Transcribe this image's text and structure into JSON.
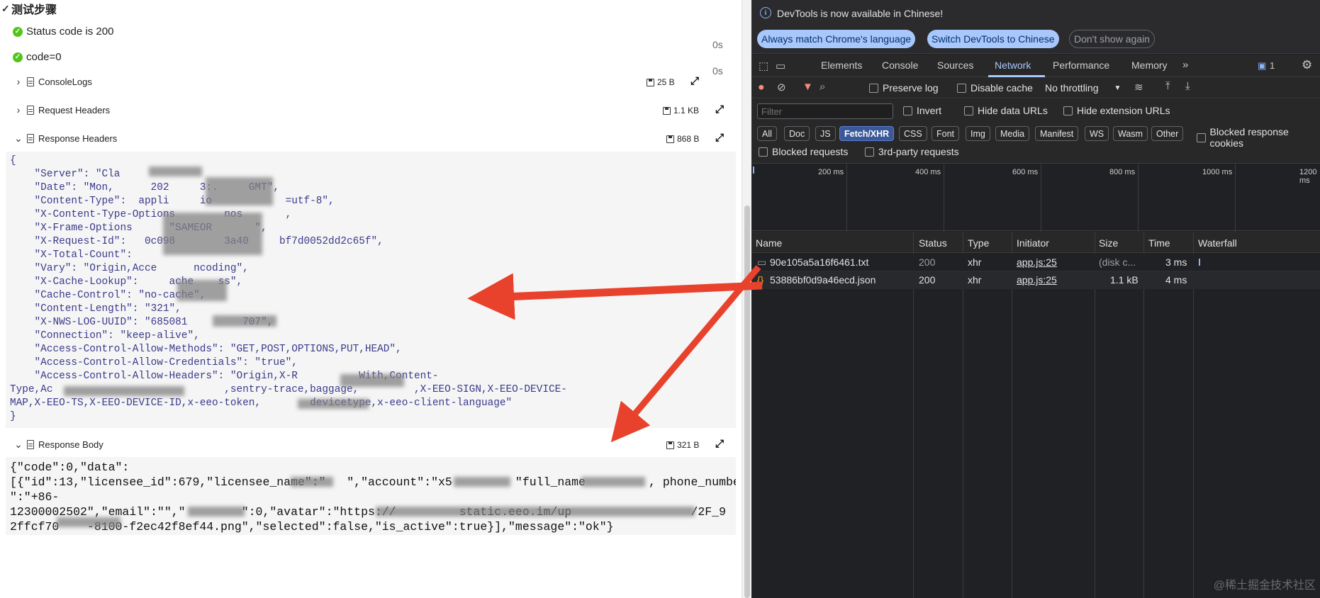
{
  "report": {
    "section_title": "测试步骤",
    "checks": [
      {
        "label": "Status code is 200",
        "duration": "0s"
      },
      {
        "label": "code=0",
        "duration": "0s"
      }
    ],
    "sections": [
      {
        "label": "ConsoleLogs",
        "size": "25 B",
        "expanded": false
      },
      {
        "label": "Request Headers",
        "size": "1.1 KB",
        "expanded": false
      },
      {
        "label": "Response Headers",
        "size": "868 B",
        "expanded": true
      },
      {
        "label": "Response Body",
        "size": "321 B",
        "expanded": true
      }
    ],
    "response_headers_lines": [
      "{",
      "    \"Server\": \"Cla",
      "    \"Date\": \"Mon,      202     3:.     GMT\",",
      "    \"Content-Type\":  appli     io            =utf-8\",",
      "    \"X-Content-Type-Options        nos       ,",
      "    \"X-Frame-Options      \"SAMEOR       \",",
      "    \"X-Request-Id\":   0c098        3a40     bf7d0052dd2c65f\",",
      "    \"X-Total-Count\":   ",
      "    \"Vary\": \"Origin,Acce      ncoding\",",
      "    \"X-Cache-Lookup\":     ache    ss\",",
      "    \"Cache-Control\": \"no-cache\",",
      "    \"Content-Length\": \"321\",",
      "    \"X-NWS-LOG-UUID\": \"685081         707\",",
      "    \"Connection\": \"keep-alive\",",
      "    \"Access-Control-Allow-Methods\": \"GET,POST,OPTIONS,PUT,HEAD\",",
      "    \"Access-Control-Allow-Credentials\": \"true\",",
      "    \"Access-Control-Allow-Headers\": \"Origin,X-R          With,Content-",
      "Type,Ac                            ,sentry-trace,baggage,         ,X-EEO-SIGN,X-EEO-DEVICE-",
      "MAP,X-EEO-TS,X-EEO-DEVICE-ID,x-eeo-token,        devicetype,x-eeo-client-language\"",
      "}"
    ],
    "response_body_lines": [
      "{\"code\":0,\"data\":",
      "[{\"id\":13,\"licensee_id\":679,\"licensee_name\":\"   \",\"account\":\"x5         \"full_name         , phone_number",
      "\":\"+86-",
      "12300002502\",\"email\":\"\",\"        \":0,\"avatar\":\"https://         static.eeo.im/up                 /2F_9",
      "2ffcf70    -8100-f2ec42f8ef44.png\",\"selected\":false,\"is_active\":true}],\"message\":\"ok\"}"
    ]
  },
  "devtools": {
    "info_text": "DevTools is now available in Chinese!",
    "info_buttons": [
      "Always match Chrome's language",
      "Switch DevTools to Chinese",
      "Don't show again"
    ],
    "tabs": [
      "Elements",
      "Console",
      "Sources",
      "Network",
      "Performance",
      "Memory"
    ],
    "active_tab": "Network",
    "issues_count": "1",
    "toolbar": {
      "preserve_log": "Preserve log",
      "disable_cache": "Disable cache",
      "throttling": "No throttling"
    },
    "filter": {
      "placeholder": "Filter",
      "invert": "Invert",
      "hide_data_urls": "Hide data URLs",
      "hide_extension_urls": "Hide extension URLs",
      "types": [
        "All",
        "Doc",
        "JS",
        "Fetch/XHR",
        "CSS",
        "Font",
        "Img",
        "Media",
        "Manifest",
        "WS",
        "Wasm",
        "Other"
      ],
      "active_type": "Fetch/XHR",
      "blocked_response_cookies": "Blocked response cookies",
      "blocked_requests": "Blocked requests",
      "third_party_requests": "3rd-party requests"
    },
    "timeline_ticks": [
      "200 ms",
      "400 ms",
      "600 ms",
      "800 ms",
      "1000 ms",
      "1200 ms"
    ],
    "columns": [
      "Name",
      "Status",
      "Type",
      "Initiator",
      "Size",
      "Time",
      "Waterfall"
    ],
    "requests": [
      {
        "name": "90e105a5a16f6461.txt",
        "status": "200",
        "type": "xhr",
        "initiator": "app.js:25",
        "size": "(disk c...",
        "time": "3 ms"
      },
      {
        "name": "53886bf0d9a46ecd.json",
        "status": "200",
        "type": "xhr",
        "initiator": "app.js:25",
        "size": "1.1 kB",
        "time": "4 ms"
      }
    ],
    "colors": {
      "accent": "#a8c7fa",
      "arrow": "#e8412c",
      "check": "#52c41a"
    }
  },
  "watermark": "@稀土掘金技术社区"
}
